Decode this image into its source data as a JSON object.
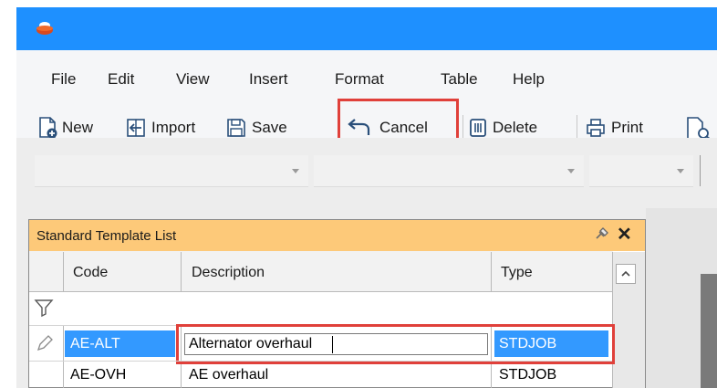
{
  "menu": {
    "items": [
      "File",
      "Edit",
      "View",
      "Insert",
      "Format",
      "Table",
      "Help"
    ]
  },
  "toolbar": {
    "new_label": "New",
    "import_label": "Import",
    "save_label": "Save",
    "cancel_label": "Cancel",
    "delete_label": "Delete",
    "print_label": "Print"
  },
  "panel": {
    "title": "Standard Template List",
    "columns": [
      "Code",
      "Description",
      "Type"
    ],
    "rows": [
      {
        "code": "AE-ALT",
        "description": "Alternator overhaul",
        "type": "STDJOB"
      },
      {
        "code": "AE-OVH",
        "description": "AE overhaul",
        "type": "STDJOB"
      }
    ]
  },
  "colors": {
    "titlebar": "#1e90ff",
    "panel_header": "#fdc979",
    "selection": "#3399ff",
    "highlight": "#e0403a"
  },
  "icons": [
    "app-icon",
    "new-icon",
    "import-icon",
    "save-icon",
    "undo-icon",
    "delete-icon",
    "print-icon",
    "preview-icon",
    "pin-icon",
    "close-icon",
    "filter-icon",
    "pencil-icon",
    "scroll-up-icon"
  ]
}
